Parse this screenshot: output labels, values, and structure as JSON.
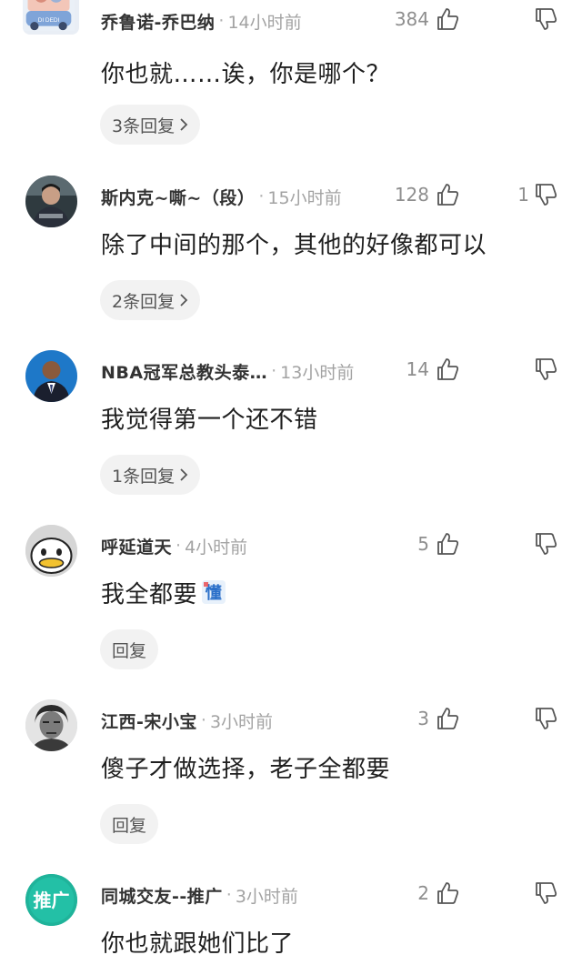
{
  "comments": [
    {
      "username": "乔鲁诺-乔巴纳",
      "time": "14小时前",
      "likes": "384",
      "dislikes": "",
      "text": "你也就……诶，你是哪个？",
      "reply_label": "3条回复",
      "avatar_icon": "anime-car-avatar",
      "avatar_text": "DI DEDI"
    },
    {
      "username": "斯内克~嘶~（段）",
      "time": "15小时前",
      "likes": "128",
      "dislikes": "1",
      "text": "除了中间的那个，其他的好像都可以",
      "reply_label": "2条回复",
      "avatar_icon": "person-photo-avatar"
    },
    {
      "username": "NBA冠军总教头泰…",
      "time": "13小时前",
      "likes": "14",
      "dislikes": "",
      "text": "我觉得第一个还不错",
      "reply_label": "1条回复",
      "avatar_icon": "suited-man-avatar"
    },
    {
      "username": "呼延道天",
      "time": "4小时前",
      "likes": "5",
      "dislikes": "",
      "text": "我全都要",
      "emoji": "懂",
      "reply_label": "回复",
      "avatar_icon": "cartoon-face-avatar"
    },
    {
      "username": "江西-宋小宝",
      "time": "3小时前",
      "likes": "3",
      "dislikes": "",
      "text": "傻子才做选择，老子全都要",
      "reply_label": "回复",
      "avatar_icon": "portrait-man-avatar"
    },
    {
      "username": "同城交友--推广",
      "time": "3小时前",
      "likes": "2",
      "dislikes": "",
      "text": "你也就跟她们比了",
      "reply_label": "",
      "avatar_icon": "promo-badge-avatar",
      "avatar_text": "推广"
    }
  ],
  "colors": {
    "username": "#333333",
    "meta": "#a3a3a3",
    "body": "#1f1f1f",
    "pill_bg": "#f2f2f2",
    "promo": "#1fb39a"
  }
}
